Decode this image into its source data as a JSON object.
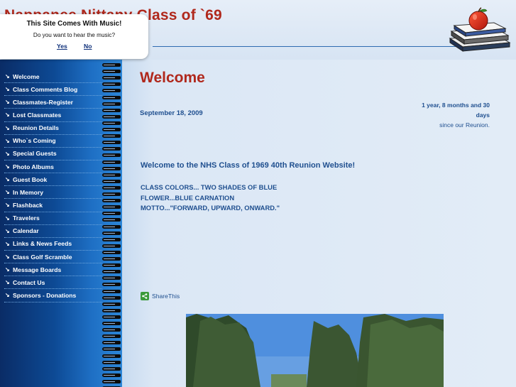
{
  "header": {
    "site_title": "Nappanee Nittany Class of `69",
    "emblem": "apple-on-books-icon"
  },
  "popup": {
    "title": "This Site Comes With Music!",
    "question": "Do you want to hear the music?",
    "yes_label": "Yes",
    "no_label": "No"
  },
  "nav": {
    "items": [
      {
        "label": "Welcome"
      },
      {
        "label": "Class Comments Blog"
      },
      {
        "label": "Classmates-Register"
      },
      {
        "label": "Lost Classmates"
      },
      {
        "label": "Reunion Details"
      },
      {
        "label": "Who`s Coming"
      },
      {
        "label": "Special Guests"
      },
      {
        "label": "Photo Albums"
      },
      {
        "label": "Guest Book"
      },
      {
        "label": "In Memory"
      },
      {
        "label": "Flashback"
      },
      {
        "label": "Travelers"
      },
      {
        "label": "Calendar"
      },
      {
        "label": "Links & News Feeds"
      },
      {
        "label": "Class Golf Scramble"
      },
      {
        "label": "Message Boards"
      },
      {
        "label": "Contact Us"
      },
      {
        "label": "Sponsors - Donations"
      }
    ]
  },
  "main": {
    "page_title": "Welcome",
    "date": "September 18, 2009",
    "countdown_bold": "1 year, 8 months and 30 days",
    "countdown_text": "since our Reunion.",
    "welcome_message": "Welcome to the NHS Class of 1969 40th Reunion Website!",
    "colors_line": "CLASS COLORS... TWO SHADES OF BLUE",
    "flower_line": "FLOWER...BLUE CARNATION",
    "motto_line": "MOTTO...\"FORWARD, UPWARD, ONWARD.\"",
    "share_label": "ShareThis"
  },
  "colors": {
    "title_red": "#b0281c",
    "text_blue": "#1f4f8f",
    "sidebar_dark": "#0a2c66",
    "sidebar_light": "#2d86d6"
  }
}
